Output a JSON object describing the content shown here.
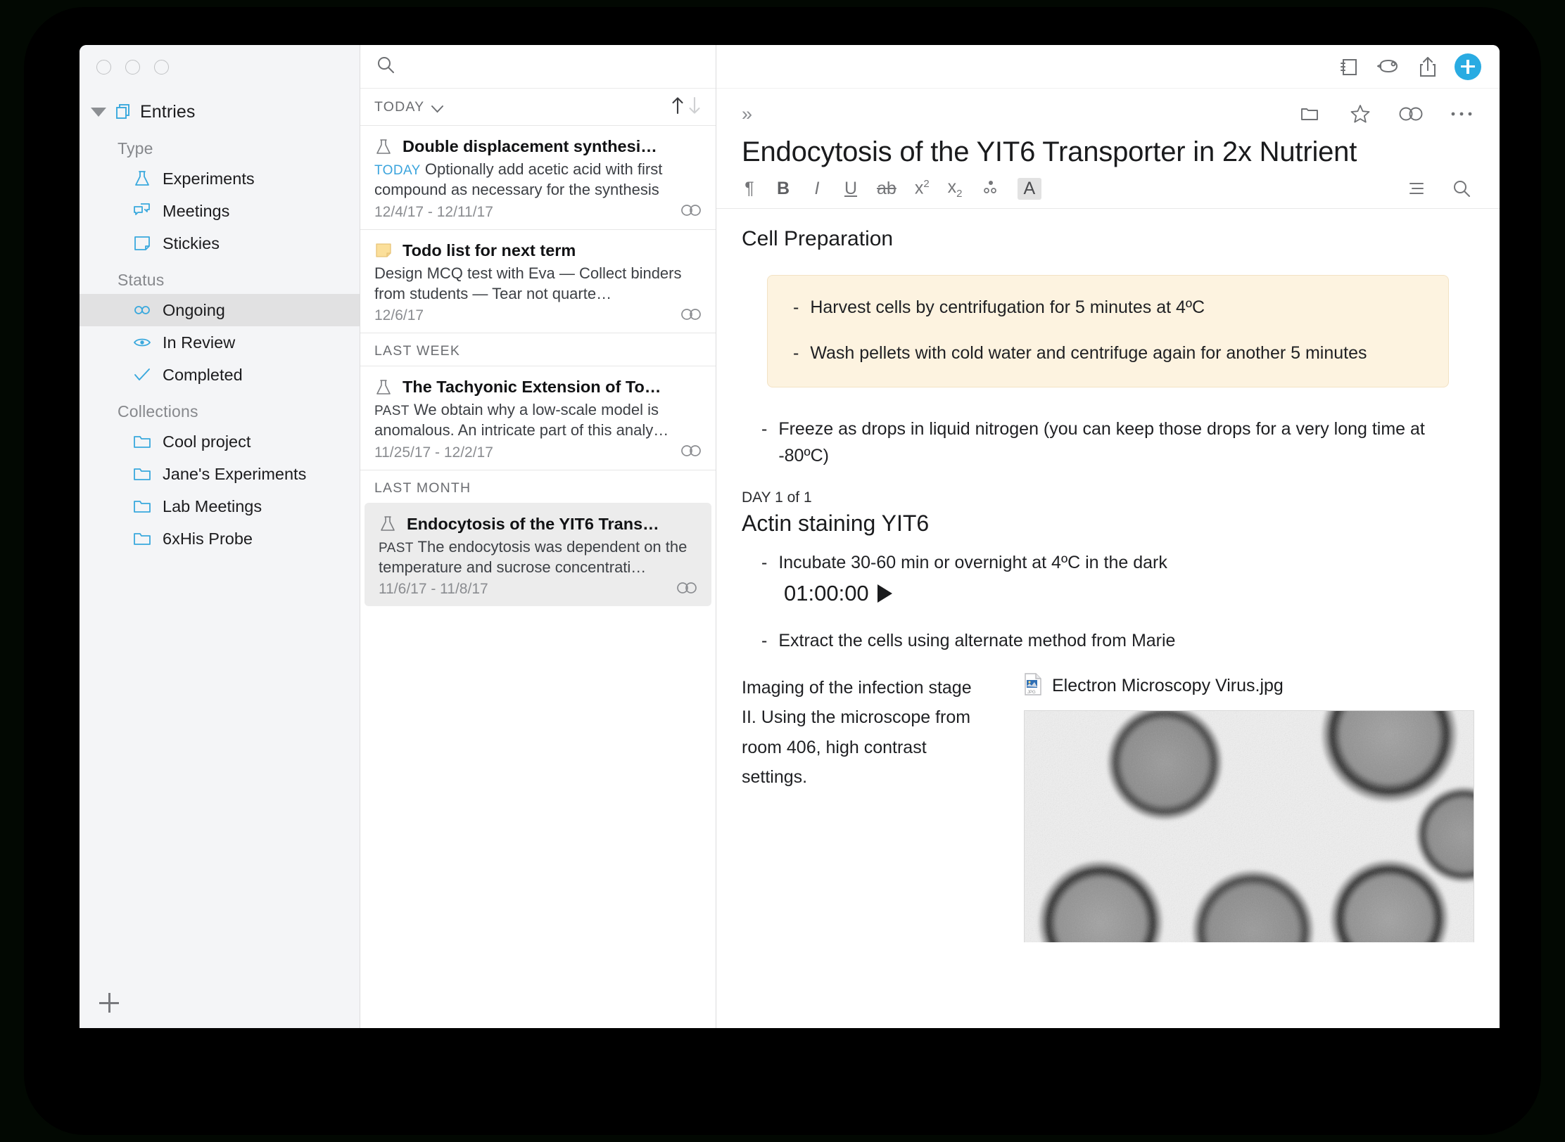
{
  "window": {
    "traffic_lights": [
      "close",
      "minimize",
      "zoom"
    ]
  },
  "toolbar": {
    "icons": [
      {
        "name": "notebook-icon",
        "label": "Notebook"
      },
      {
        "name": "mouse-icon",
        "label": "Pointer"
      },
      {
        "name": "share-icon",
        "label": "Share"
      },
      {
        "name": "add-icon",
        "label": "+"
      }
    ],
    "accent_color": "#29abe2"
  },
  "search": {
    "placeholder": "",
    "value": "",
    "icon": "search-icon"
  },
  "sidebar": {
    "root": {
      "label": "Entries",
      "icon": "entries-icon"
    },
    "groups": [
      {
        "label": "Type",
        "items": [
          {
            "label": "Experiments",
            "icon": "flask-icon",
            "selected": false
          },
          {
            "label": "Meetings",
            "icon": "speech-bubbles-icon",
            "selected": false
          },
          {
            "label": "Stickies",
            "icon": "sticky-note-icon",
            "selected": false
          }
        ]
      },
      {
        "label": "Status",
        "items": [
          {
            "label": "Ongoing",
            "icon": "infinity-icon",
            "selected": true
          },
          {
            "label": "In Review",
            "icon": "eye-icon",
            "selected": false
          },
          {
            "label": "Completed",
            "icon": "check-icon",
            "selected": false
          }
        ]
      },
      {
        "label": "Collections",
        "items": [
          {
            "label": "Cool project",
            "icon": "folder-icon",
            "selected": false
          },
          {
            "label": "Jane's Experiments",
            "icon": "folder-icon",
            "selected": false
          },
          {
            "label": "Lab Meetings",
            "icon": "folder-icon",
            "selected": false
          },
          {
            "label": "6xHis Probe",
            "icon": "folder-icon",
            "selected": false
          }
        ]
      }
    ],
    "add_button": "+"
  },
  "list": {
    "header": {
      "label": "TODAY",
      "chevron": "chevron-down-icon"
    },
    "sort": {
      "ascending_active": true,
      "descending_active": false
    },
    "sections": [
      {
        "heading": null,
        "entries": [
          {
            "icon": "flask-icon",
            "title": "Double displacement synthesi…",
            "tag": "TODAY",
            "tag_style": "today",
            "snippet": "Optionally add acetic acid with first compound as necessary for the synthesis",
            "date": "12/4/17 - 12/11/17",
            "status_icon": "infinity-icon",
            "selected": false
          },
          {
            "icon": "sticky-note-icon",
            "title": "Todo list for next term",
            "tag": "",
            "tag_style": "none",
            "snippet": "Design MCQ test with Eva — Collect binders from students — Tear not quarte…",
            "date": "12/6/17",
            "status_icon": "infinity-icon",
            "selected": false
          }
        ]
      },
      {
        "heading": "LAST WEEK",
        "entries": [
          {
            "icon": "flask-icon",
            "title": "The Tachyonic Extension of To…",
            "tag": "PAST",
            "tag_style": "past",
            "snippet": "We obtain why a low-scale model is anomalous. An intricate part of this analy…",
            "date": "11/25/17 - 12/2/17",
            "status_icon": "infinity-icon",
            "selected": false
          }
        ]
      },
      {
        "heading": "LAST MONTH",
        "entries": [
          {
            "icon": "flask-icon",
            "title": "Endocytosis of the YIT6 Trans…",
            "tag": "PAST",
            "tag_style": "past",
            "snippet": "The endocytosis was dependent on the temperature and sucrose concentrati…",
            "date": "11/6/17 - 11/8/17",
            "status_icon": "infinity-icon",
            "selected": true
          }
        ]
      }
    ]
  },
  "detail": {
    "expand_glyph": "»",
    "header_icons": [
      {
        "name": "folder-icon"
      },
      {
        "name": "star-icon"
      },
      {
        "name": "infinity-icon"
      },
      {
        "name": "more-icon"
      }
    ],
    "title": "Endocytosis of the YIT6 Transporter in 2x Nutrient",
    "format_bar": {
      "left": [
        {
          "name": "paragraph-icon",
          "label": "¶"
        },
        {
          "name": "bold-button",
          "label": "B"
        },
        {
          "name": "italic-button",
          "label": "I"
        },
        {
          "name": "underline-button",
          "label": "U"
        },
        {
          "name": "strikethrough-button",
          "label": "ab"
        },
        {
          "name": "superscript-button",
          "label": "x2"
        },
        {
          "name": "subscript-button",
          "label": "x2"
        },
        {
          "name": "molecule-button",
          "label": "∴"
        },
        {
          "name": "text-color-button",
          "label": "A",
          "active": true
        }
      ],
      "right": [
        {
          "name": "list-view-icon"
        },
        {
          "name": "search-in-note-icon"
        }
      ]
    },
    "body": {
      "section_heading": "Cell Preparation",
      "callout": {
        "background": "#fdf3e0",
        "border": "#f2e2c4",
        "bullets": [
          "Harvest cells by centrifugation for 5 minutes at 4ºC",
          "Wash pellets with cold water and centrifuge again for another 5 minutes"
        ]
      },
      "bullets_after_callout": [
        "Freeze as drops in liquid nitrogen (you can keep those drops for a very long time at -80ºC)"
      ],
      "day_label": "DAY 1 of 1",
      "day_heading": "Actin staining YIT6",
      "day_bullets": [
        "Incubate 30-60 min or overnight at 4ºC in the dark"
      ],
      "timer": {
        "value": "01:00:00",
        "play_icon": "play-icon"
      },
      "day_bullets_after_timer": [
        "Extract the cells using alternate method from Marie"
      ],
      "bottom_paragraph": "Imaging of the infection stage II. Using the microscope from room 406, high contrast settings.",
      "attachment": {
        "file_icon": "jpg-file-icon",
        "filename": "Electron Microscopy Virus.jpg",
        "alt": "Electron microscopy image of virus particles"
      }
    }
  }
}
